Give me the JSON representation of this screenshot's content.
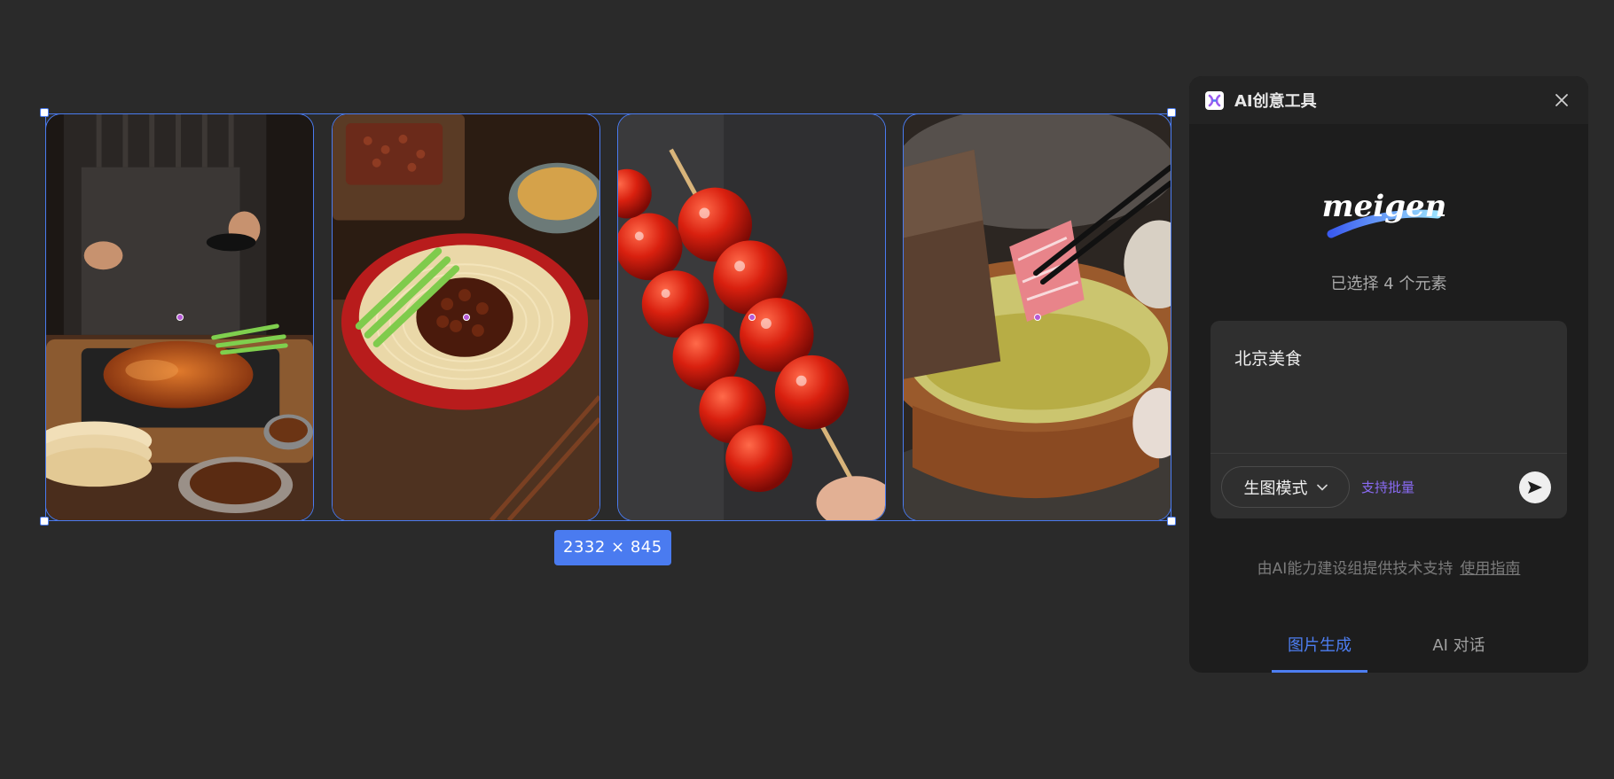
{
  "canvas": {
    "images": [
      {
        "name": "peking-duck-image",
        "alt": "Peking duck"
      },
      {
        "name": "zhajiang-noodles-image",
        "alt": "Zhajiang noodles"
      },
      {
        "name": "tanghulu-image",
        "alt": "Tanghulu skewer"
      },
      {
        "name": "copper-hotpot-image",
        "alt": "Copper hotpot"
      }
    ],
    "size_label": "2332 × 845"
  },
  "panel": {
    "title": "AI创意工具",
    "logo_text": "meigen",
    "selected_count_text": "已选择 4 个元素",
    "prompt_text": "北京美食",
    "mode_label": "生图模式",
    "batch_label": "支持批量",
    "support_text": "由AI能力建设组提供技术支持",
    "guide_link": "使用指南",
    "tabs": [
      {
        "label": "图片生成",
        "active": true
      },
      {
        "label": "AI 对话",
        "active": false
      }
    ]
  },
  "colors": {
    "accent": "#4a7bf0",
    "batch_link": "#8a6bf5",
    "background": "#2a2a2a",
    "panel": "#1d1d1d"
  },
  "icons": [
    "app-logo-icon",
    "close-icon",
    "chevron-down-icon",
    "send-icon"
  ]
}
